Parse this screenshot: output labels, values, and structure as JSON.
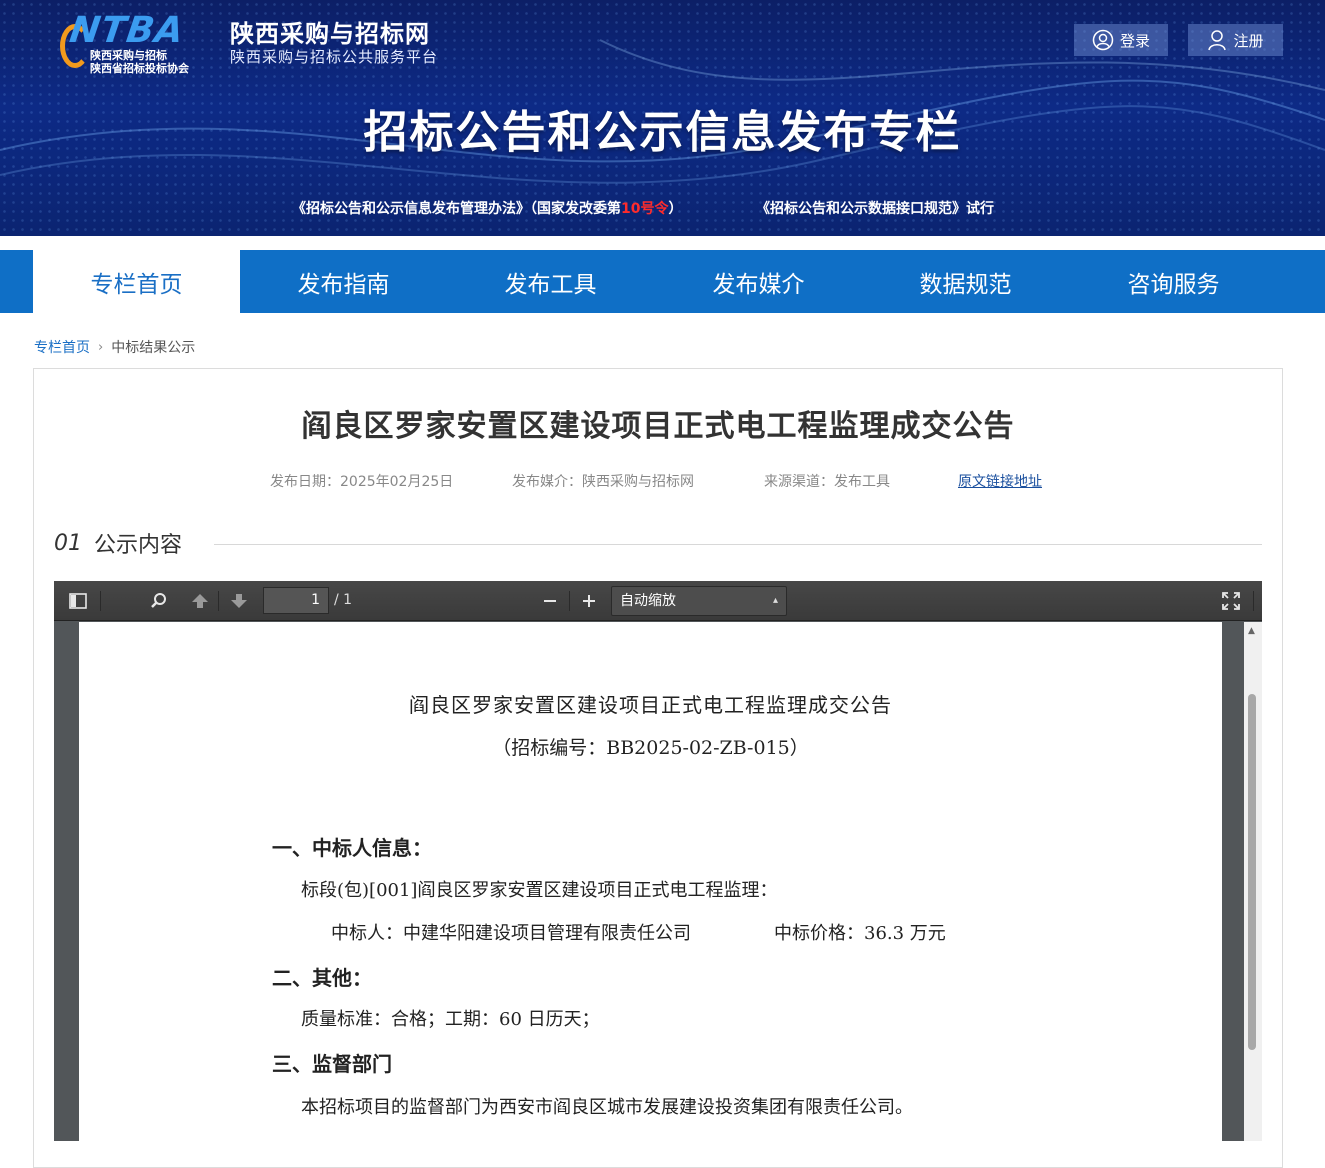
{
  "header": {
    "logo_text": "NTBA",
    "association_line1": "陕西采购与招标",
    "association_line2": "陕西省招标投标协会",
    "site_name": "陕西采购与招标网",
    "site_subtitle": "陕西采购与招标公共服务平台",
    "login_label": "登录",
    "register_label": "注册",
    "banner_title": "招标公告和公示信息发布专栏",
    "note_left_prefix": "《招标公告和公示信息发布管理办法》（国家发改委第",
    "note_left_highlight": "10号令",
    "note_left_suffix": "）",
    "note_right": "《招标公告和公示数据接口规范》试行"
  },
  "nav": {
    "items": [
      "专栏首页",
      "发布指南",
      "发布工具",
      "发布媒介",
      "数据规范",
      "咨询服务"
    ],
    "active_index": 0
  },
  "breadcrumb": {
    "home": "专栏首页",
    "current": "中标结果公示"
  },
  "article": {
    "title": "阎良区罗家安置区建设项目正式电工程监理成交公告",
    "publish_date": "发布日期：2025年02月25日",
    "media": "发布媒介：陕西采购与招标网",
    "channel": "来源渠道：发布工具",
    "original_link": "原文链接地址",
    "section_num": "01",
    "section_label": "公示内容"
  },
  "pdf_viewer": {
    "current_page": "1",
    "total_pages": "/ 1",
    "zoom": "自动缩放",
    "scroll_fraction": 0.0
  },
  "document": {
    "title": "阎良区罗家安置区建设项目正式电工程监理成交公告",
    "code": "（招标编号：BB2025-02-ZB-015）",
    "h1": "一、中标人信息：",
    "lot": "标段(包)[001]阎良区罗家安置区建设项目正式电工程监理：",
    "winner": "中标人：中建华阳建设项目管理有限责任公司",
    "price": "中标价格：36.3 万元",
    "h2": "二、其他：",
    "quality": "质量标准：合格；工期：60 日历天；",
    "h3": "三、监督部门",
    "supervisor": "本招标项目的监督部门为西安市阎良区城市发展建设投资集团有限责任公司。"
  },
  "colors": {
    "nav_blue": "#0f6fc6",
    "banner_navy": "#0d2a86",
    "highlight_red": "#ff2b2b",
    "link_blue": "#1a6fc5"
  }
}
